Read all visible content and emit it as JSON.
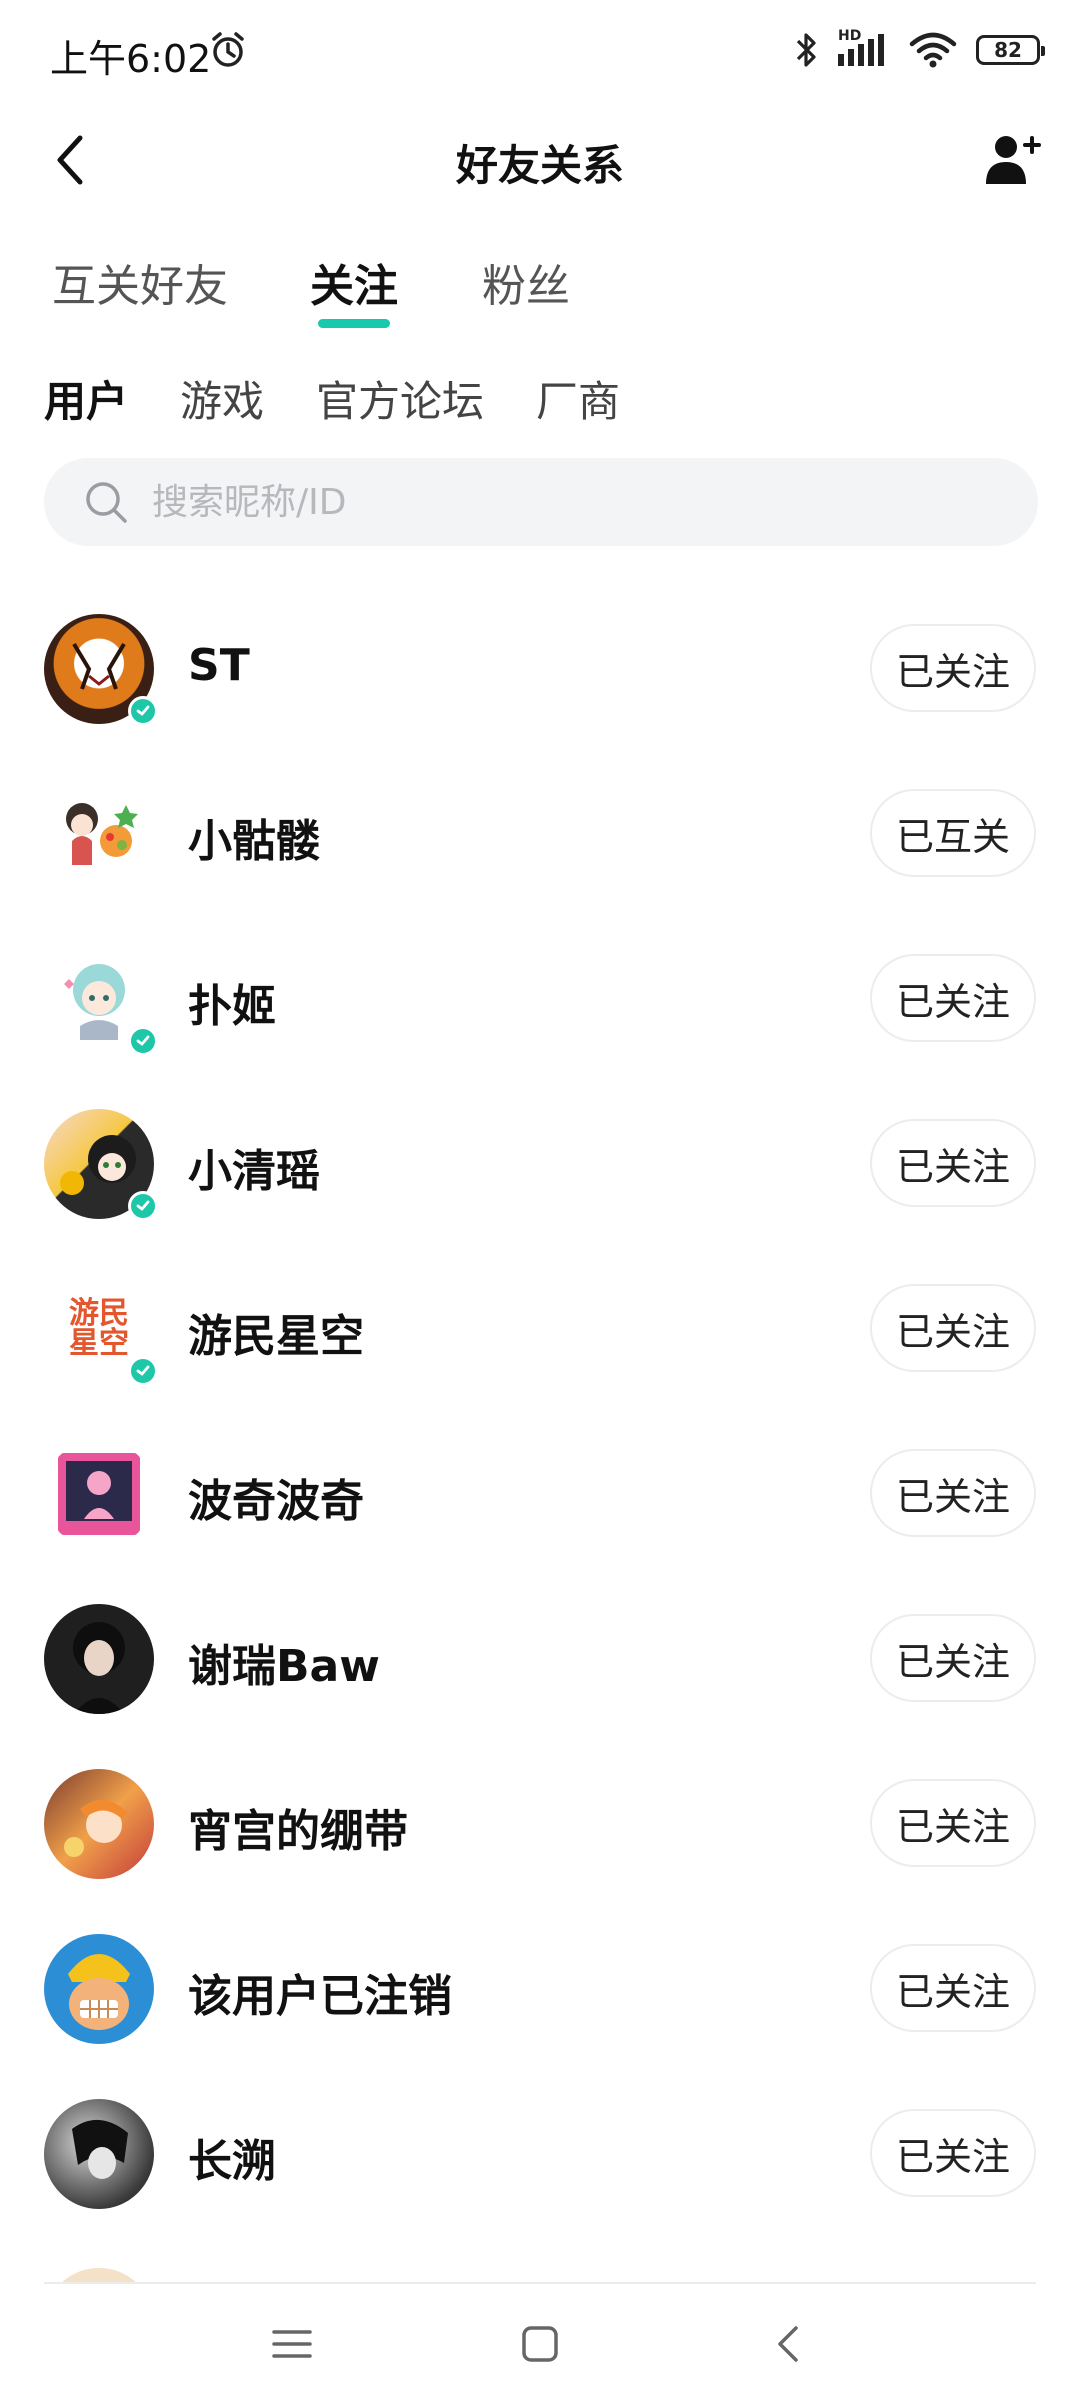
{
  "status_bar": {
    "time": "上午6:02",
    "hd_label": "HD",
    "battery": "82",
    "icons": [
      "alarm-icon",
      "bluetooth-icon",
      "signal-icon",
      "wifi-icon",
      "battery-icon"
    ]
  },
  "header": {
    "title": "好友关系",
    "back_icon": "chevron-left-icon",
    "add_icon": "add-user-icon"
  },
  "tabs": [
    {
      "label": "互关好友",
      "active": false
    },
    {
      "label": "关注",
      "active": true
    },
    {
      "label": "粉丝",
      "active": false
    }
  ],
  "subtabs": [
    {
      "label": "用户",
      "active": true
    },
    {
      "label": "游戏",
      "active": false
    },
    {
      "label": "官方论坛",
      "active": false
    },
    {
      "label": "厂商",
      "active": false
    }
  ],
  "search": {
    "placeholder": "搜索昵称/ID",
    "value": ""
  },
  "accent_color": "#17c9ad",
  "users": [
    {
      "name": "ST",
      "button": "已关注",
      "verified": true
    },
    {
      "name": "小骷髅",
      "button": "已互关",
      "verified": false
    },
    {
      "name": "扑姬",
      "button": "已关注",
      "verified": true
    },
    {
      "name": "小清瑶",
      "button": "已关注",
      "verified": true
    },
    {
      "name": "游民星空",
      "button": "已关注",
      "verified": true,
      "avatar_text": "游民星空"
    },
    {
      "name": "波奇波奇",
      "button": "已关注",
      "verified": false
    },
    {
      "name": "谢瑞Baw",
      "button": "已关注",
      "verified": false
    },
    {
      "name": "宵宫的绷带",
      "button": "已关注",
      "verified": false
    },
    {
      "name": "该用户已注销",
      "button": "已关注",
      "verified": false
    },
    {
      "name": "长溯",
      "button": "已关注",
      "verified": false
    }
  ],
  "nav_bar": {
    "icons": [
      "menu-icon",
      "home-square-icon",
      "back-triangle-icon"
    ]
  }
}
